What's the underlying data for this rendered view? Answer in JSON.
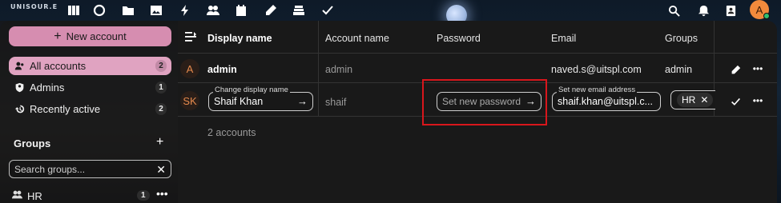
{
  "header": {
    "logo": "UNISOUR.E",
    "apps": [
      {
        "name": "dashboard-icon"
      },
      {
        "name": "search-circle-icon"
      },
      {
        "name": "files-icon"
      },
      {
        "name": "photos-icon"
      },
      {
        "name": "activity-icon"
      },
      {
        "name": "contacts-icon"
      },
      {
        "name": "calendar-icon"
      },
      {
        "name": "notes-icon"
      },
      {
        "name": "deck-icon"
      },
      {
        "name": "tasks-icon"
      }
    ],
    "avatar_initial": "A"
  },
  "sidebar": {
    "new_account_label": "New account",
    "items": [
      {
        "label": "All accounts",
        "count": "2",
        "icon": "account-group-icon",
        "active": true
      },
      {
        "label": "Admins",
        "count": "1",
        "icon": "shield-account-icon",
        "active": false
      },
      {
        "label": "Recently active",
        "count": "2",
        "icon": "history-icon",
        "active": false
      }
    ],
    "groups_title": "Groups",
    "group_search_placeholder": "Search groups...",
    "groups": [
      {
        "label": "HR",
        "count": "1"
      }
    ]
  },
  "table": {
    "columns": {
      "display_name": "Display name",
      "account_name": "Account name",
      "password": "Password",
      "email": "Email",
      "groups": "Groups"
    },
    "rows": [
      {
        "avatar": "A",
        "display_name": "admin",
        "account_name": "admin",
        "email": "naved.s@uitspl.com",
        "groups": "admin"
      },
      {
        "avatar": "SK",
        "display_name_label": "Change display name",
        "display_name_value": "Shaif Khan",
        "account_name": "shaif",
        "password_placeholder": "Set new password",
        "email_label": "Set new email address",
        "email_value": "shaif.khan@uitspl.c...",
        "group_tag": "HR"
      }
    ],
    "footer": "2 accounts"
  },
  "colors": {
    "accent": "#d68db0",
    "active_nav": "#e0a3c1",
    "highlight_box": "#d8161c",
    "avatar_orange": "#f18a3c"
  }
}
